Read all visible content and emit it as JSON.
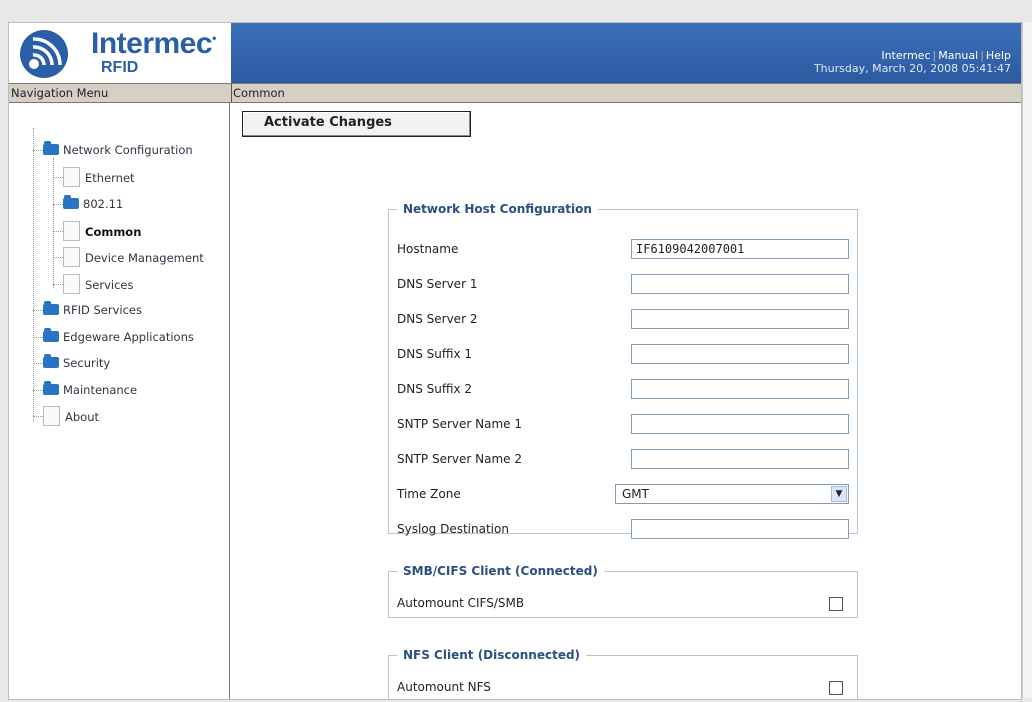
{
  "header": {
    "brand": "Intermec",
    "brand_mark": "•",
    "product": "RFID",
    "links": [
      "Intermec",
      "Manual",
      "Help"
    ],
    "datetime": "Thursday, March 20, 2008 05:41:47",
    "banner_color": "#2d5aa1"
  },
  "bar": {
    "nav_title": "Navigation Menu",
    "section_title": "Common"
  },
  "nav": {
    "network_configuration": "Network Configuration",
    "ethernet": "Ethernet",
    "wifi": "802.11",
    "common": "Common",
    "device_management": "Device Management",
    "services": "Services",
    "rfid_services": "RFID Services",
    "edgeware_applications": "Edgeware Applications",
    "security": "Security",
    "maintenance": "Maintenance",
    "about": "About"
  },
  "main": {
    "activate_label": "Activate Changes",
    "network_host": {
      "legend": "Network Host Configuration",
      "hostname_label": "Hostname",
      "hostname_value": "IF6109042007001",
      "dns1_label": "DNS Server 1",
      "dns1_value": "",
      "dns2_label": "DNS Server 2",
      "dns2_value": "",
      "suffix1_label": "DNS Suffix 1",
      "suffix1_value": "",
      "suffix2_label": "DNS Suffix 2",
      "suffix2_value": "",
      "sntp1_label": "SNTP Server Name 1",
      "sntp1_value": "",
      "sntp2_label": "SNTP Server Name 2",
      "sntp2_value": "",
      "timezone_label": "Time Zone",
      "timezone_value": "GMT",
      "syslog_label": "Syslog Destination",
      "syslog_value": ""
    },
    "smb": {
      "legend": "SMB/CIFS Client (Connected)",
      "automount_label": "Automount CIFS/SMB",
      "checked": false
    },
    "nfs": {
      "legend": "NFS Client (Disconnected)",
      "automount_label": "Automount NFS",
      "checked": false
    }
  }
}
